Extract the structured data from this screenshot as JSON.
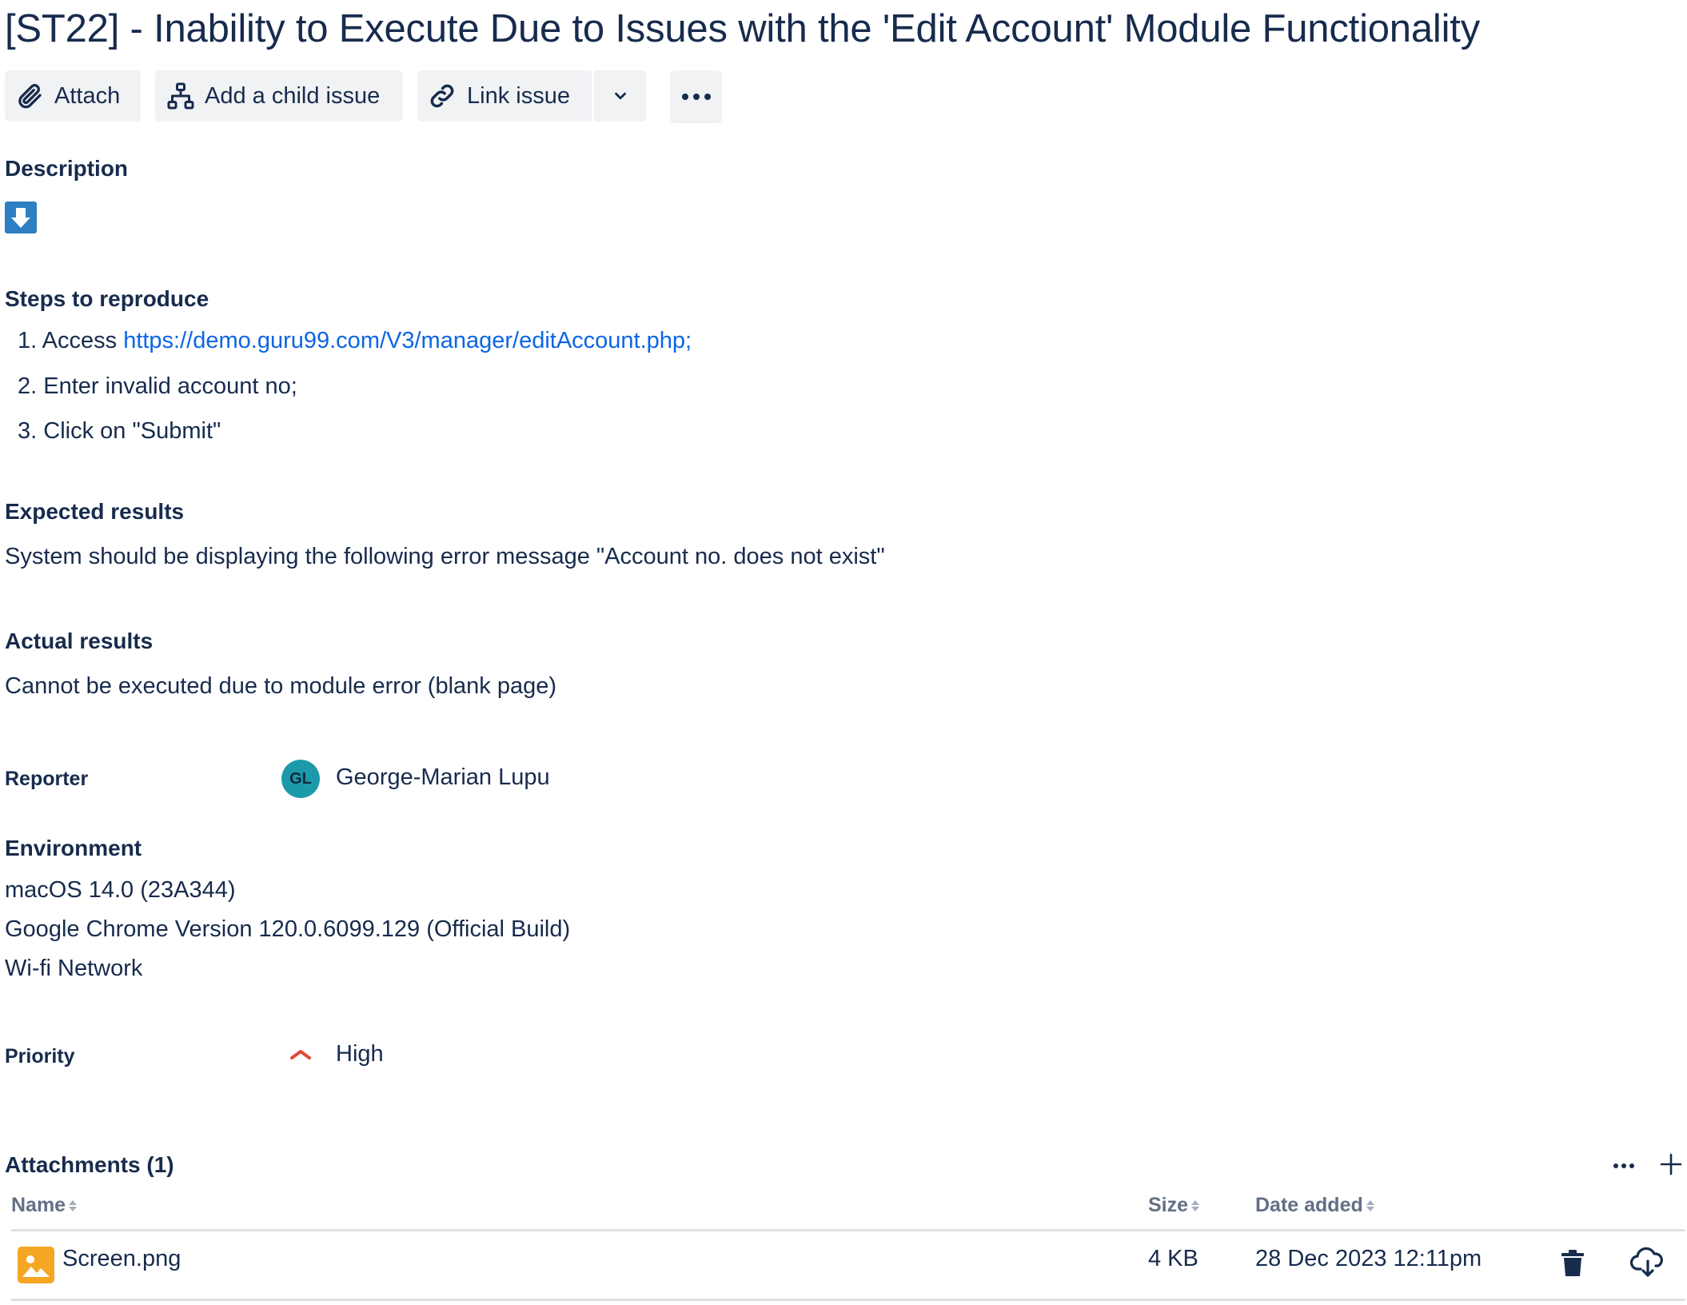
{
  "issue": {
    "title": "[ST22] - Inability to Execute Due to Issues with the 'Edit Account' Module Functionality"
  },
  "toolbar": {
    "attach_label": "Attach",
    "child_issue_label": "Add a child issue",
    "link_issue_label": "Link issue"
  },
  "description": {
    "heading": "Description",
    "steps_heading": "Steps to reproduce",
    "steps": [
      {
        "num": "1.",
        "text": "Access ",
        "link": "https://demo.guru99.com/V3/manager/editAccount.php;"
      },
      {
        "num": "2.",
        "text": "Enter invalid account no;"
      },
      {
        "num": "3.",
        "text": "Click on \"Submit\""
      }
    ],
    "expected_heading": "Expected results",
    "expected_text": "System should be displaying the following error message \"Account no. does not exist\"",
    "actual_heading": "Actual results",
    "actual_text": "Cannot be executed due to module error (blank page)"
  },
  "reporter": {
    "label": "Reporter",
    "initials": "GL",
    "name": "George-Marian Lupu",
    "avatar_color": "#1d9aaa"
  },
  "environment": {
    "heading": "Environment",
    "lines": [
      "macOS 14.0 (23A344)",
      "Google Chrome Version 120.0.6099.129 (Official Build)",
      "Wi-fi Network"
    ]
  },
  "priority": {
    "label": "Priority",
    "value": "High",
    "icon": "priority-high-icon",
    "color": "#e2483d"
  },
  "attachments": {
    "heading": "Attachments (1)",
    "columns": {
      "name": "Name",
      "size": "Size",
      "date": "Date added"
    },
    "rows": [
      {
        "name": "Screen.png",
        "size": "4 KB",
        "date": "28 Dec 2023 12:11pm",
        "icon": "image-file-icon"
      }
    ]
  },
  "colors": {
    "text": "#172b4d",
    "link": "#0c66e4",
    "button_bg": "#f1f2f4",
    "file_icon": "#f5a623",
    "download_icon": "#2d7fc1"
  }
}
